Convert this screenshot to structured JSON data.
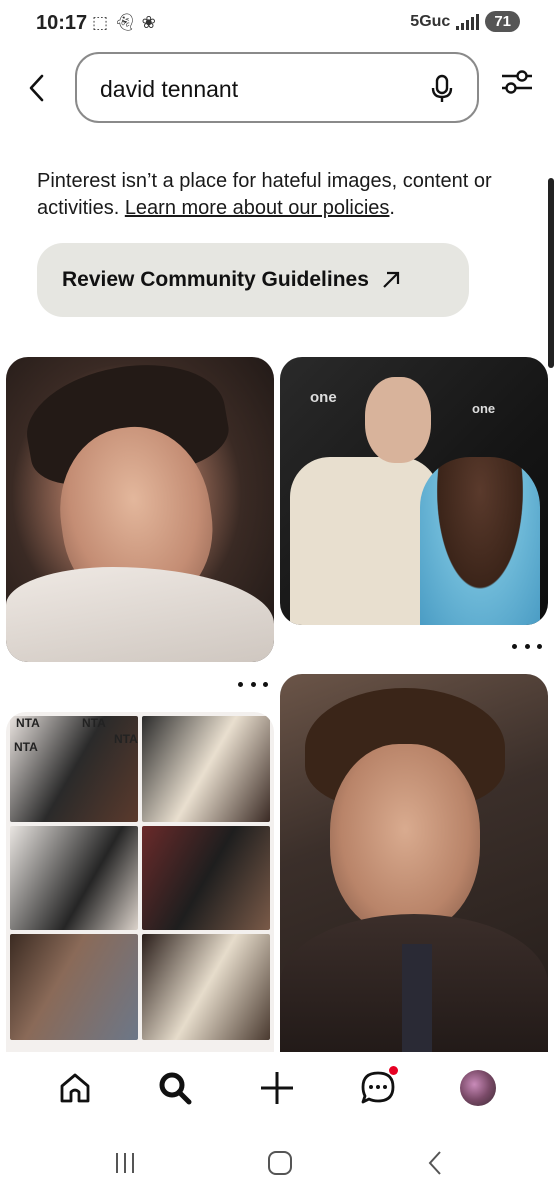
{
  "status_bar": {
    "time": "10:17",
    "network": "5Guc",
    "battery": "71"
  },
  "search": {
    "query": "david tennant"
  },
  "notice": {
    "text_before": "Pinterest isn’t a place for hateful images, content or activities. ",
    "link": "Learn more about our policies",
    "text_after": "."
  },
  "guidelines_button": {
    "label": "Review Community Guidelines"
  },
  "pins": [
    {
      "overlay_logos": []
    },
    {
      "overlay_logos": [
        "one",
        "one"
      ]
    },
    {
      "overlay_logos": [
        "NTA",
        "NTA",
        "NTA",
        "NTA"
      ]
    },
    {
      "overlay_logos": []
    }
  ],
  "bottom_nav": {
    "items": [
      "home-icon",
      "search-icon",
      "create-icon",
      "messages-icon",
      "profile-avatar"
    ],
    "has_notification": true,
    "accent": "#e60023"
  }
}
